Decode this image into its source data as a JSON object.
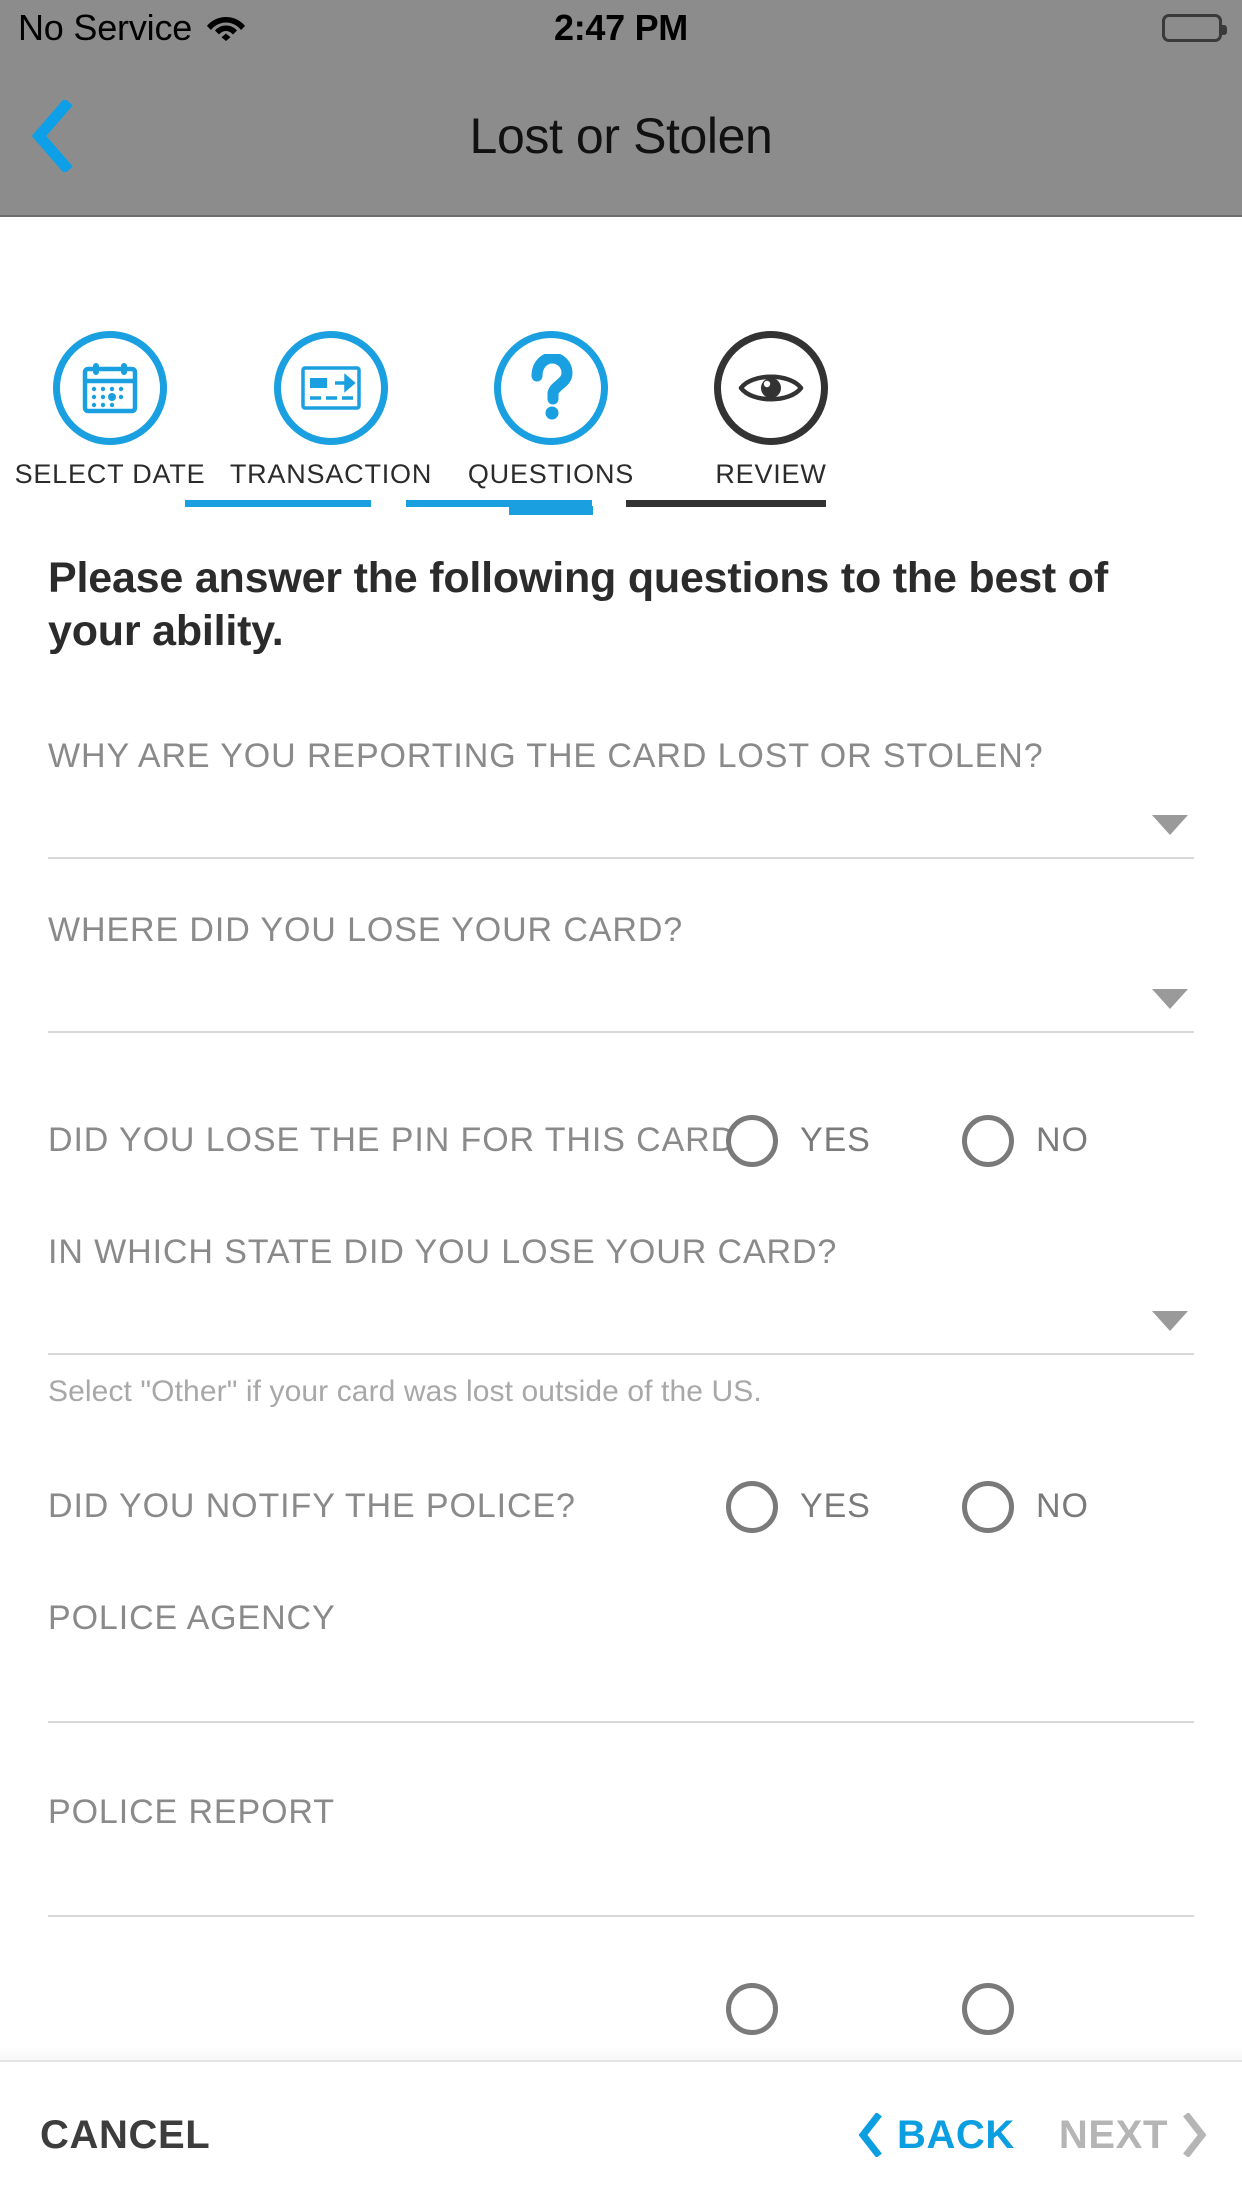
{
  "status_bar": {
    "carrier": "No Service",
    "time": "2:47 PM",
    "wifi_icon": "wifi-icon",
    "battery_icon": "battery-full-icon"
  },
  "nav": {
    "title": "Lost or Stolen",
    "back_icon": "chevron-left-icon"
  },
  "stepper": {
    "active_index": 2,
    "steps": [
      {
        "label": "SELECT DATE",
        "icon": "calendar-icon",
        "state": "complete"
      },
      {
        "label": "TRANSACTION",
        "icon": "transaction-card-icon",
        "state": "complete"
      },
      {
        "label": "QUESTIONS",
        "icon": "question-mark-icon",
        "state": "active"
      },
      {
        "label": "REVIEW",
        "icon": "eye-icon",
        "state": "upcoming"
      }
    ],
    "colors": {
      "active": "#1a9fe0",
      "inactive": "#333333"
    }
  },
  "form": {
    "intro": "Please answer the following questions to the best of your ability.",
    "fields": [
      {
        "type": "select",
        "label": "WHY ARE YOU REPORTING THE CARD LOST OR STOLEN?",
        "value": "",
        "caret_icon": "caret-down-icon"
      },
      {
        "type": "select",
        "label": "WHERE DID YOU LOSE YOUR CARD?",
        "value": "",
        "caret_icon": "caret-down-icon"
      },
      {
        "type": "radio",
        "label": "DID YOU LOSE THE PIN FOR THIS CARD?",
        "options": [
          {
            "label": "YES",
            "selected": false
          },
          {
            "label": "NO",
            "selected": false
          }
        ]
      },
      {
        "type": "select",
        "label": "IN WHICH STATE DID YOU LOSE YOUR CARD?",
        "value": "",
        "caret_icon": "caret-down-icon",
        "hint": "Select \"Other\" if your card was lost outside of the US."
      },
      {
        "type": "radio",
        "label": "DID YOU NOTIFY THE POLICE?",
        "options": [
          {
            "label": "YES",
            "selected": false
          },
          {
            "label": "NO",
            "selected": false
          }
        ]
      },
      {
        "type": "text",
        "label": "POLICE AGENCY",
        "value": ""
      },
      {
        "type": "text",
        "label": "POLICE REPORT",
        "value": ""
      }
    ]
  },
  "footer": {
    "cancel_label": "CANCEL",
    "back_label": "BACK",
    "next_label": "NEXT",
    "back_icon": "chevron-left-icon",
    "next_icon": "chevron-right-icon",
    "next_enabled": false
  }
}
